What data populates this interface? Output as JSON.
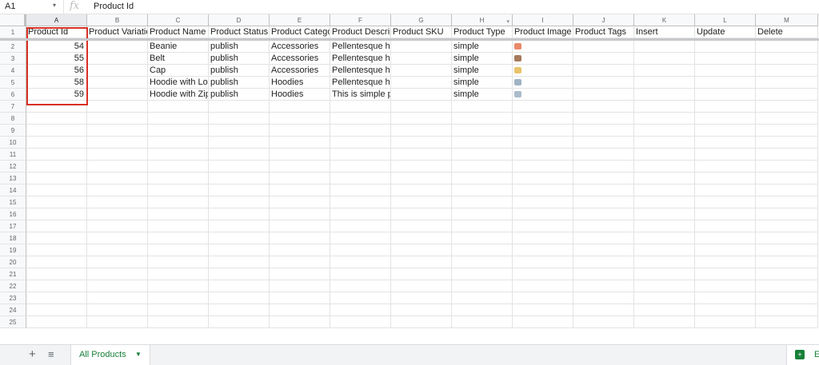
{
  "formula_bar": {
    "cell_ref": "A1",
    "fx": "fx",
    "formula": "Product Id"
  },
  "columns": [
    "A",
    "B",
    "C",
    "D",
    "E",
    "F",
    "G",
    "H",
    "I",
    "J",
    "K",
    "L",
    "M"
  ],
  "header_row": [
    "Product Id",
    "Product Variatior",
    "Product Name",
    "Product Status",
    "Product Categor",
    "Product Descript",
    "Product SKU",
    "Product Type",
    "Product Image",
    "Product Tags",
    "Insert",
    "Update",
    "Delete"
  ],
  "data_rows": [
    {
      "id": "54",
      "name": "Beanie",
      "status": "publish",
      "category": "Accessories",
      "description": "Pellentesque habitant morbi tristic",
      "type": "simple",
      "thumb_color": "#e9896a"
    },
    {
      "id": "55",
      "name": "Belt",
      "status": "publish",
      "category": "Accessories",
      "description": "Pellentesque habitant morbi tristic",
      "type": "simple",
      "thumb_color": "#a67b5b"
    },
    {
      "id": "56",
      "name": "Cap",
      "status": "publish",
      "category": "Accessories",
      "description": "Pellentesque habitant morbi tristic",
      "type": "simple",
      "thumb_color": "#e8c46a"
    },
    {
      "id": "58",
      "name": "Hoodie with Logo",
      "status": "publish",
      "category": "Hoodies",
      "description": "Pellentesque habitant morbi tristic",
      "type": "simple",
      "thumb_color": "#9fb3c4"
    },
    {
      "id": "59",
      "name": "Hoodie with Zipp",
      "status": "publish",
      "category": "Hoodies",
      "description": "This is simple product",
      "type": "simple",
      "thumb_color": "#aabccc"
    }
  ],
  "row_numbers": [
    "1",
    "2",
    "3",
    "4",
    "5",
    "6",
    "7",
    "8",
    "9",
    "10",
    "11",
    "12",
    "13",
    "14",
    "15",
    "16",
    "17",
    "18",
    "19",
    "20",
    "21",
    "22",
    "23",
    "24",
    "25"
  ],
  "bottom_bar": {
    "add_sheet": "+",
    "all_sheets": "≡",
    "sheet_tab": "All Products",
    "explore": "E"
  }
}
